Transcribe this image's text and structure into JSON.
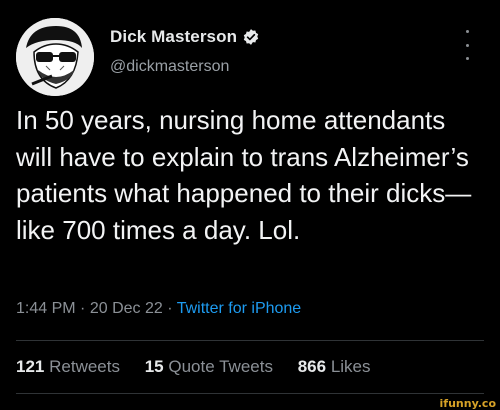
{
  "author": {
    "display_name": "Dick Masterson",
    "handle": "@dickmasterson",
    "avatar_icon": "illustrated-man-with-sunglasses-and-cigarette",
    "verified_icon": "verified-badge-icon"
  },
  "tweet": {
    "text": "In 50 years, nursing home attendants will have to explain to trans Alzheimer’s patients what happened to their dicks—like 700 times a day. Lol.",
    "time": "1:44 PM",
    "separator": "·",
    "date": "20 Dec 22",
    "source": "Twitter for iPhone"
  },
  "stats": {
    "retweets_count": "121",
    "retweets_label": "Retweets",
    "quotes_count": "15",
    "quotes_label": "Quote Tweets",
    "likes_count": "866",
    "likes_label": "Likes"
  },
  "watermark": "ifunny.co",
  "colors": {
    "background": "#000000",
    "link": "#1d9bf0",
    "muted": "#8b9096",
    "verified": "#e7e9ea"
  }
}
